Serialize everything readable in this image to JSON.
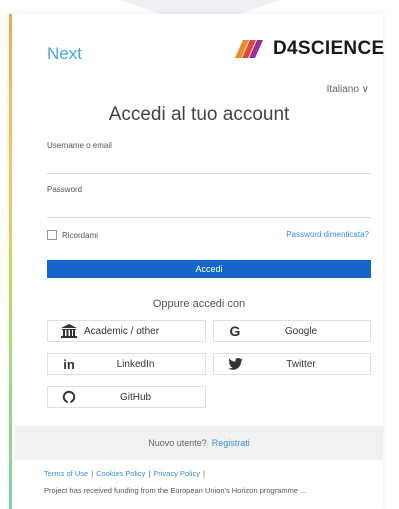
{
  "header": {
    "next_label": "Next",
    "brand": "D4SCIENCE",
    "language": "Italiano ∨"
  },
  "login": {
    "title": "Accedi al tuo account",
    "username_label": "Username o email",
    "username_value": "",
    "password_label": "Password",
    "password_value": "",
    "remember_label": "Ricordami",
    "forgot_label": "Password dimenticata?",
    "submit_label": "Accedi"
  },
  "social": {
    "title": "Oppure accedi con",
    "providers": [
      {
        "label": "Academic / other",
        "icon": "institution-icon"
      },
      {
        "label": "Google",
        "icon": "google-icon"
      },
      {
        "label": "LinkedIn",
        "icon": "linkedin-icon"
      },
      {
        "label": "Twitter",
        "icon": "twitter-icon"
      },
      {
        "label": "GitHub",
        "icon": "github-icon"
      }
    ]
  },
  "footer": {
    "new_user_text": "Nuovo utente?",
    "register_label": "Registrati",
    "links": [
      "Terms of Use",
      "Cookies Policy",
      "Privacy Policy"
    ],
    "trailing_separator": "|",
    "funding_text": "Project has received funding from the European Union's Horizon programme ..."
  },
  "colors": {
    "accent": "#1466c8",
    "link": "#3b8ed6",
    "next": "#4aa6d9"
  }
}
